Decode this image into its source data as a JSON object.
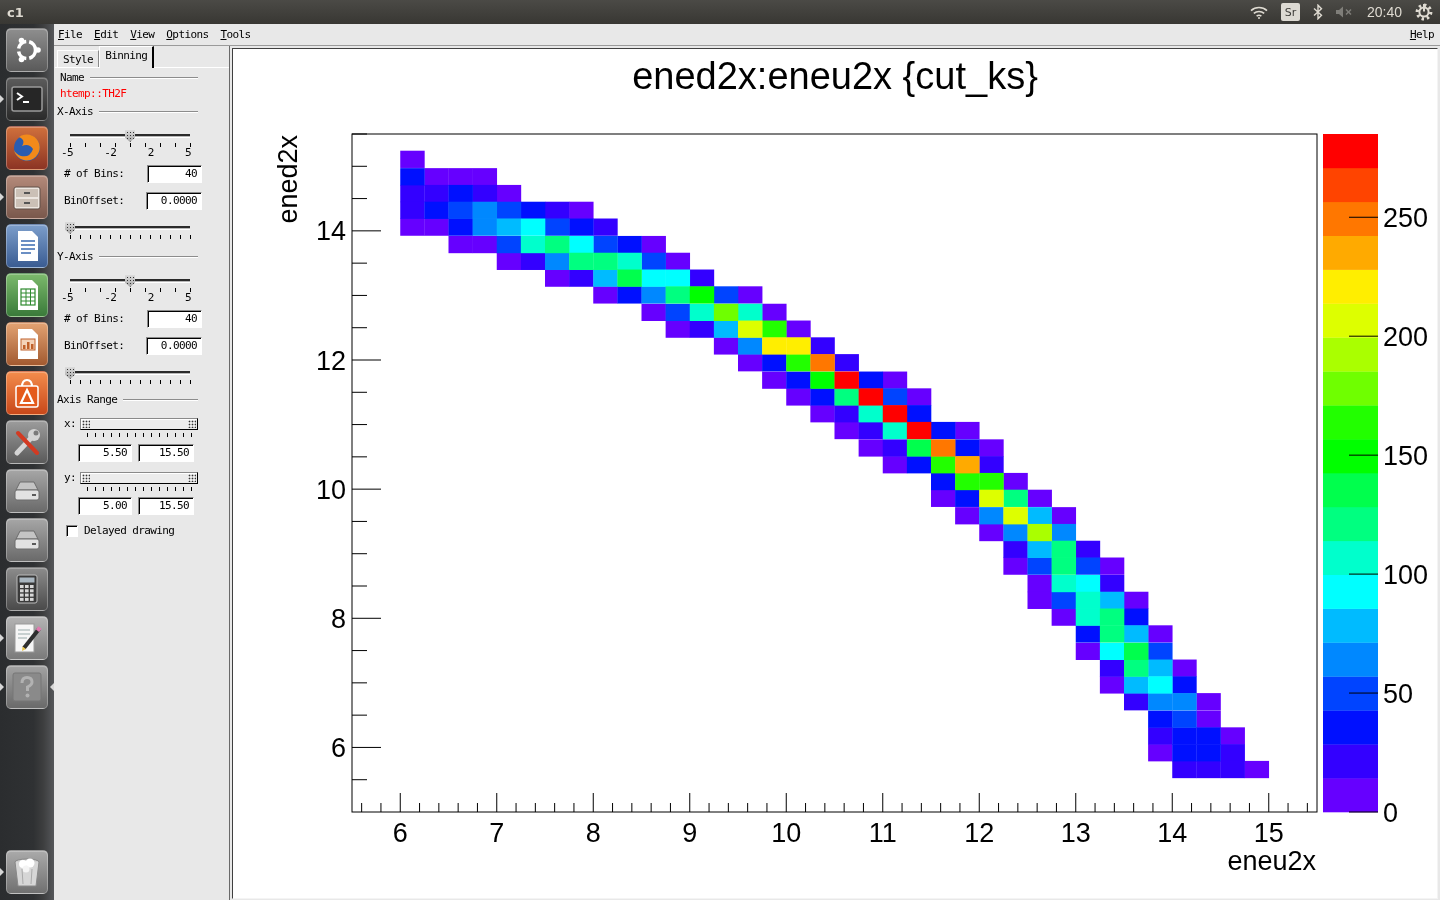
{
  "top_bar": {
    "title": "c1",
    "keyboard_layout": "Sr",
    "clock": "20:40"
  },
  "launcher": {
    "items": [
      {
        "running": false,
        "focused": false
      },
      {
        "running": true,
        "focused": false
      },
      {
        "running": false,
        "focused": false
      },
      {
        "running": true,
        "focused": false
      },
      {
        "running": false,
        "focused": false
      },
      {
        "running": false,
        "focused": false
      },
      {
        "running": false,
        "focused": false
      },
      {
        "running": false,
        "focused": false
      },
      {
        "running": false,
        "focused": false
      },
      {
        "running": false,
        "focused": false
      },
      {
        "running": false,
        "focused": false
      },
      {
        "running": false,
        "focused": false
      },
      {
        "running": true,
        "focused": false
      },
      {
        "running": true,
        "focused": true
      },
      {
        "running": true,
        "focused": false
      }
    ]
  },
  "menu_bar": {
    "items": [
      "File",
      "Edit",
      "View",
      "Options",
      "Tools"
    ],
    "help": "Help"
  },
  "editor": {
    "tabs": [
      {
        "label": "Style",
        "selected": false
      },
      {
        "label": "Binning",
        "selected": true
      }
    ],
    "name_heading": "Name",
    "object_name": "htemp::TH2F",
    "axes": [
      {
        "heading": "X-Axis",
        "rebin_slider": {
          "level": 0.5,
          "scale_labels": [
            "-5",
            "-2",
            "2",
            "5"
          ]
        },
        "bins": {
          "label": "# of Bins:",
          "value": "40"
        },
        "offset": {
          "label": "BinOffset:",
          "value": "0.0000"
        },
        "offset_slider": {
          "level": 0
        }
      },
      {
        "heading": "Y-Axis",
        "rebin_slider": {
          "level": 0.5,
          "scale_labels": [
            "-5",
            "-2",
            "2",
            "5"
          ]
        },
        "bins": {
          "label": "# of Bins:",
          "value": "40"
        },
        "offset": {
          "label": "BinOffset:",
          "value": "0.0000"
        },
        "offset_slider": {
          "level": 0
        }
      }
    ],
    "range_heading": "Axis Range",
    "ranges": [
      {
        "label": "x:",
        "slider": {
          "level": 1
        },
        "min": "5.50",
        "max": "15.50"
      },
      {
        "label": "y:",
        "slider": {
          "level": 1
        },
        "min": "5.00",
        "max": "15.50"
      }
    ],
    "delayed_drawing": {
      "label": "Delayed drawing",
      "checked": false
    }
  },
  "canvas": {
    "chart_data": {
      "type": "scatter",
      "title": "ened2x:eneu2x {cut_ks}",
      "xlabel": "eneu2x",
      "ylabel": "ened2x",
      "xlim": [
        5.5,
        15.5
      ],
      "ylim": [
        5,
        15.5
      ],
      "xticks": [
        6,
        7,
        8,
        9,
        10,
        11,
        12,
        13,
        14,
        15
      ],
      "yticks": [
        6,
        8,
        10,
        12,
        14
      ],
      "x": [
        6.125,
        6.375,
        6.625,
        6.875,
        7.125,
        7.375,
        7.625,
        7.875,
        8.125,
        8.375,
        8.625,
        8.875,
        9.125,
        9.375,
        9.625,
        9.875,
        10.125,
        10.375,
        10.625,
        10.875,
        11.125,
        11.375,
        11.625,
        11.875,
        12.125,
        12.375,
        12.625,
        12.875,
        13.125,
        13.375,
        13.625,
        13.875,
        14.125,
        14.375,
        14.625,
        14.875
      ],
      "series": [
        {
          "color": "#6600ff",
          "values": [
            15.11,
            14.84,
            14.84,
            14.84,
            14.58,
            null,
            13.27,
            14.32,
            13.01,
            null,
            13.79,
            13.53,
            null,
            12.22,
            13.01,
            12.74,
            12.48,
            11.17,
            10.91,
            10.64,
            11.69,
            11.43,
            9.86,
            10.91,
            10.64,
            10.12,
            9.86,
            9.59,
            7.49,
            8.81,
            8.28,
            7.76,
            7.23,
            6.71,
            6.18,
            5.66
          ]
        },
        {
          "color": "#6600ff",
          "values": [
            14.06,
            14.06,
            13.79,
            13.79,
            13.53,
            null,
            null,
            null,
            null,
            null,
            12.74,
            12.48,
            null,
            null,
            11.96,
            11.69,
            11.43,
            null,
            null,
            null,
            10.38,
            null,
            null,
            9.59,
            9.33,
            8.81,
            8.54,
            8.02,
            null,
            6.97,
            null,
            5.92,
            null,
            6.44,
            null,
            null
          ]
        },
        {
          "color": "#6600ff",
          "values": [
            null,
            null,
            null,
            null,
            null,
            null,
            null,
            null,
            null,
            null,
            null,
            null,
            null,
            null,
            null,
            null,
            null,
            null,
            null,
            null,
            null,
            null,
            null,
            null,
            null,
            null,
            8.28,
            null,
            null,
            null,
            null,
            null,
            null,
            null,
            null,
            null
          ]
        },
        {
          "color": "#3300ff",
          "values": [
            14.58,
            14.58,
            null,
            14.58,
            null,
            13.53,
            14.32,
            13.27,
            14.06,
            null,
            null,
            null,
            13.27,
            null,
            null,
            null,
            null,
            12.22,
            11.96,
            10.91,
            10.64,
            null,
            null,
            null,
            10.38,
            9.07,
            null,
            null,
            9.07,
            8.54,
            6.71,
            6.18,
            5.66,
            5.66,
            5.92,
            null
          ]
        },
        {
          "color": "#3300ff",
          "values": [
            14.32,
            null,
            null,
            null,
            null,
            null,
            null,
            null,
            null,
            null,
            null,
            null,
            12.48,
            null,
            null,
            null,
            null,
            null,
            11.17,
            null,
            null,
            null,
            null,
            null,
            null,
            null,
            null,
            null,
            null,
            7.23,
            null,
            null,
            null,
            null,
            5.66,
            null
          ]
        },
        {
          "color": "#0010ff",
          "values": [
            14.84,
            14.32,
            14.58,
            null,
            null,
            14.32,
            null,
            14.06,
            null,
            13.79,
            null,
            null,
            null,
            null,
            null,
            11.96,
            11.69,
            11.43,
            null,
            11.69,
            null,
            11.17,
            10.91,
            10.64,
            null,
            null,
            null,
            null,
            7.76,
            null,
            8.02,
            6.44,
            6.97,
            6.18,
            null,
            null
          ]
        },
        {
          "color": "#0010ff",
          "values": [
            null,
            null,
            14.06,
            null,
            null,
            null,
            null,
            null,
            null,
            13.01,
            null,
            null,
            null,
            null,
            null,
            null,
            null,
            null,
            null,
            null,
            null,
            10.38,
            10.12,
            9.86,
            null,
            null,
            null,
            null,
            null,
            null,
            null,
            null,
            6.18,
            5.92,
            null,
            null
          ]
        },
        {
          "color": "#0010ff",
          "values": [
            null,
            null,
            null,
            null,
            null,
            null,
            null,
            null,
            null,
            null,
            null,
            null,
            null,
            null,
            null,
            null,
            null,
            null,
            null,
            null,
            null,
            null,
            null,
            null,
            null,
            null,
            null,
            null,
            null,
            null,
            null,
            null,
            5.92,
            null,
            null,
            null
          ]
        },
        {
          "color": "#0044ff",
          "values": [
            null,
            null,
            14.32,
            null,
            14.32,
            null,
            14.06,
            null,
            13.79,
            null,
            13.53,
            12.74,
            null,
            13.01,
            null,
            null,
            null,
            null,
            null,
            null,
            11.43,
            null,
            null,
            null,
            null,
            null,
            8.81,
            8.28,
            8.81,
            null,
            null,
            7.49,
            6.44,
            null,
            null,
            null
          ]
        },
        {
          "color": "#0044ff",
          "values": [
            null,
            null,
            null,
            null,
            13.79,
            null,
            null,
            null,
            null,
            null,
            null,
            null,
            null,
            null,
            null,
            null,
            null,
            null,
            null,
            null,
            null,
            null,
            null,
            null,
            null,
            null,
            null,
            null,
            null,
            null,
            null,
            null,
            null,
            null,
            null,
            null
          ]
        },
        {
          "color": "#0088ff",
          "values": [
            null,
            null,
            null,
            14.32,
            null,
            null,
            13.53,
            null,
            null,
            null,
            13.01,
            null,
            null,
            null,
            12.22,
            null,
            null,
            null,
            null,
            null,
            null,
            null,
            null,
            null,
            9.59,
            9.33,
            null,
            9.33,
            null,
            null,
            null,
            6.71,
            6.71,
            null,
            null,
            null
          ]
        },
        {
          "color": "#0088ff",
          "values": [
            null,
            null,
            null,
            14.06,
            null,
            null,
            null,
            null,
            null,
            null,
            null,
            null,
            null,
            null,
            null,
            null,
            null,
            null,
            null,
            null,
            null,
            null,
            null,
            null,
            null,
            null,
            null,
            null,
            null,
            null,
            null,
            null,
            null,
            null,
            null,
            null
          ]
        },
        {
          "color": "#00bbff",
          "values": [
            null,
            null,
            null,
            null,
            14.06,
            null,
            null,
            null,
            13.27,
            null,
            null,
            null,
            null,
            12.48,
            null,
            null,
            null,
            null,
            null,
            null,
            null,
            null,
            null,
            null,
            null,
            null,
            9.59,
            null,
            null,
            8.28,
            7.76,
            7.23,
            null,
            null,
            null,
            null
          ]
        },
        {
          "color": "#00bbff",
          "values": [
            null,
            null,
            null,
            null,
            null,
            null,
            null,
            null,
            null,
            null,
            null,
            null,
            null,
            null,
            null,
            null,
            null,
            null,
            null,
            null,
            null,
            null,
            null,
            null,
            null,
            null,
            9.07,
            null,
            null,
            null,
            6.97,
            null,
            null,
            null,
            null,
            null
          ]
        },
        {
          "color": "#00ffff",
          "values": [
            null,
            null,
            null,
            null,
            null,
            14.06,
            null,
            13.79,
            null,
            null,
            13.27,
            13.27,
            null,
            null,
            null,
            null,
            null,
            null,
            null,
            null,
            null,
            null,
            null,
            null,
            null,
            null,
            null,
            null,
            8.54,
            7.49,
            null,
            6.97,
            null,
            null,
            null,
            null
          ]
        },
        {
          "color": "#00ffcc",
          "values": [
            null,
            null,
            null,
            null,
            null,
            13.79,
            null,
            null,
            null,
            13.53,
            null,
            null,
            12.74,
            null,
            12.74,
            null,
            null,
            null,
            null,
            11.17,
            10.91,
            null,
            null,
            null,
            null,
            null,
            null,
            8.54,
            8.28,
            null,
            null,
            null,
            null,
            null,
            null,
            null
          ]
        },
        {
          "color": "#00ffcc",
          "values": [
            null,
            null,
            null,
            null,
            null,
            null,
            null,
            null,
            null,
            null,
            null,
            null,
            null,
            null,
            null,
            null,
            null,
            null,
            null,
            null,
            null,
            null,
            null,
            null,
            null,
            null,
            null,
            null,
            8.02,
            null,
            null,
            null,
            null,
            null,
            null,
            null
          ]
        },
        {
          "color": "#00ff80",
          "values": [
            null,
            null,
            null,
            null,
            null,
            null,
            13.79,
            13.53,
            13.53,
            null,
            null,
            13.01,
            null,
            null,
            null,
            null,
            null,
            null,
            11.43,
            null,
            null,
            null,
            null,
            null,
            null,
            9.86,
            null,
            9.07,
            null,
            8.02,
            7.23,
            null,
            null,
            null,
            null,
            null
          ]
        },
        {
          "color": "#00ff80",
          "values": [
            null,
            null,
            null,
            null,
            null,
            null,
            null,
            null,
            null,
            null,
            null,
            null,
            null,
            null,
            null,
            null,
            null,
            null,
            null,
            null,
            null,
            null,
            null,
            null,
            null,
            null,
            null,
            8.81,
            null,
            7.76,
            null,
            null,
            null,
            null,
            null,
            null
          ]
        },
        {
          "color": "#00ff4d",
          "values": [
            null,
            null,
            null,
            null,
            null,
            null,
            null,
            null,
            null,
            13.27,
            null,
            null,
            null,
            null,
            null,
            null,
            null,
            null,
            null,
            null,
            null,
            10.64,
            null,
            null,
            null,
            null,
            null,
            null,
            null,
            null,
            7.49,
            null,
            null,
            null,
            null,
            null
          ]
        },
        {
          "color": "#00ff00",
          "values": [
            null,
            null,
            null,
            null,
            null,
            null,
            null,
            null,
            null,
            null,
            null,
            null,
            13.01,
            null,
            null,
            null,
            null,
            11.69,
            null,
            null,
            null,
            null,
            null,
            null,
            null,
            null,
            null,
            null,
            null,
            null,
            null,
            null,
            null,
            null,
            null,
            null
          ]
        },
        {
          "color": "#22ff00",
          "values": [
            null,
            null,
            null,
            null,
            null,
            null,
            null,
            null,
            null,
            null,
            null,
            null,
            null,
            null,
            null,
            12.48,
            11.96,
            null,
            null,
            null,
            null,
            null,
            10.38,
            10.12,
            10.12,
            null,
            null,
            null,
            null,
            null,
            null,
            null,
            null,
            null,
            null,
            null
          ]
        },
        {
          "color": "#6fff00",
          "values": [
            null,
            null,
            null,
            null,
            null,
            null,
            null,
            null,
            null,
            null,
            null,
            null,
            null,
            12.74,
            null,
            null,
            null,
            null,
            null,
            null,
            null,
            null,
            null,
            null,
            null,
            null,
            null,
            null,
            null,
            null,
            null,
            null,
            null,
            null,
            null,
            null
          ]
        },
        {
          "color": "#aaff00",
          "values": [
            null,
            null,
            null,
            null,
            null,
            null,
            null,
            null,
            null,
            null,
            null,
            null,
            null,
            null,
            null,
            null,
            null,
            null,
            null,
            null,
            null,
            null,
            null,
            null,
            null,
            null,
            9.33,
            null,
            null,
            null,
            null,
            null,
            null,
            null,
            null,
            null
          ]
        },
        {
          "color": "#ddff00",
          "values": [
            null,
            null,
            null,
            null,
            null,
            null,
            null,
            null,
            null,
            null,
            null,
            null,
            null,
            null,
            12.48,
            null,
            null,
            null,
            null,
            null,
            null,
            null,
            null,
            null,
            9.86,
            9.59,
            null,
            null,
            null,
            null,
            null,
            null,
            null,
            null,
            null,
            null
          ]
        },
        {
          "color": "#ffee00",
          "values": [
            null,
            null,
            null,
            null,
            null,
            null,
            null,
            null,
            null,
            null,
            null,
            null,
            null,
            null,
            null,
            12.22,
            12.22,
            null,
            null,
            null,
            null,
            null,
            null,
            null,
            null,
            null,
            null,
            null,
            null,
            null,
            null,
            null,
            null,
            null,
            null,
            null
          ]
        },
        {
          "color": "#ffaa00",
          "values": [
            null,
            null,
            null,
            null,
            null,
            null,
            null,
            null,
            null,
            null,
            null,
            null,
            null,
            null,
            null,
            null,
            null,
            null,
            null,
            null,
            null,
            null,
            null,
            10.38,
            null,
            null,
            null,
            null,
            null,
            null,
            null,
            null,
            null,
            null,
            null,
            null
          ]
        },
        {
          "color": "#ff7700",
          "values": [
            null,
            null,
            null,
            null,
            null,
            null,
            null,
            null,
            null,
            null,
            null,
            null,
            null,
            null,
            null,
            null,
            null,
            11.96,
            null,
            null,
            null,
            null,
            10.64,
            null,
            null,
            null,
            null,
            null,
            null,
            null,
            null,
            null,
            null,
            null,
            null,
            null
          ]
        },
        {
          "color": "#ff0000",
          "values": [
            null,
            null,
            null,
            null,
            null,
            null,
            null,
            null,
            null,
            null,
            null,
            null,
            null,
            null,
            null,
            null,
            null,
            null,
            11.69,
            11.43,
            11.17,
            10.91,
            null,
            null,
            null,
            null,
            null,
            null,
            null,
            null,
            null,
            null,
            null,
            null,
            null,
            null
          ]
        }
      ]
    },
    "color_scale": {
      "labels": [
        "250",
        "200",
        "150",
        "100",
        "50",
        "0"
      ]
    }
  }
}
